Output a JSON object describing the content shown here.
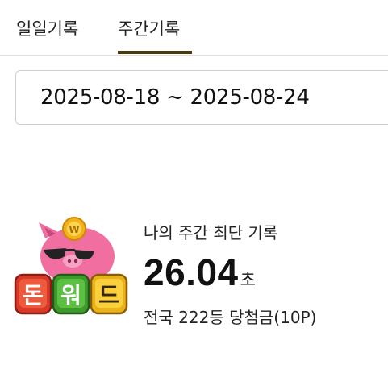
{
  "tabs": [
    {
      "label": "일일기록",
      "active": false
    },
    {
      "label": "주간기록",
      "active": true
    }
  ],
  "date_range": {
    "value": "2025-08-18 ~ 2025-08-24"
  },
  "logo": {
    "tiles": [
      "돈",
      "워",
      "드"
    ],
    "coin_letter": "W"
  },
  "record": {
    "title": "나의 주간 최단 기록",
    "time_value": "26.04",
    "time_unit": "초",
    "rank_text": "전국 222등 당첨금(10P)"
  },
  "colors": {
    "tab_underline": "#4a3b0e",
    "pig_pink": "#f06fa0",
    "coin_gold": "#f3b21b"
  }
}
